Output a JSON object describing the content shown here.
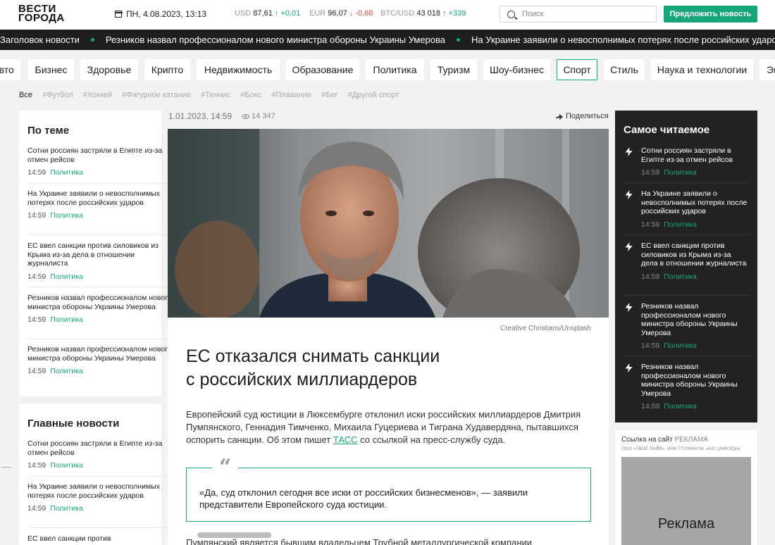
{
  "header": {
    "logo_line1": "ВЕСТИ",
    "logo_line2": "ГОРОДА",
    "date": "ПН, 4.08.2023, 13:13",
    "rates": [
      {
        "label": "USD",
        "value": "87,61",
        "change": "↑ +0,01",
        "dir": "up"
      },
      {
        "label": "EUR",
        "value": "96,07",
        "change": "↓ -0,68",
        "dir": "down"
      },
      {
        "label": "BTC/USD",
        "value": "43 018",
        "change": "↑ +339",
        "dir": "up"
      }
    ],
    "search_placeholder": "Поиск",
    "suggest_button": "Предложить новость"
  },
  "ticker": [
    "Заголовок новости",
    "Резников назвал профессионалом нового министра обороны Украины Умерова",
    "На Украине заявили о невосполнимых потерях после российских ударов"
  ],
  "categories": [
    "Авто",
    "Бизнес",
    "Здоровье",
    "Крипто",
    "Недвижимость",
    "Образование",
    "Политика",
    "Туризм",
    "Шоу-бизнес",
    "Спорт",
    "Стиль",
    "Наука и технологии",
    "Экономика"
  ],
  "active_category": "Спорт",
  "tags": [
    "Все",
    "#Футбол",
    "#Хоккей",
    "#Фигурное катание",
    "#Теннис",
    "#Бокс",
    "#Плавание",
    "#Бег",
    "#Другой спорт"
  ],
  "left": {
    "topic": {
      "title": "По теме",
      "items": [
        {
          "text": "Сотни россиян застряли в Египте из-за отмен рейсов",
          "time": "14:59",
          "rubric": "Политика"
        },
        {
          "text": "На Украине заявили о невосполнимых потерях после российских ударов",
          "time": "14:59",
          "rubric": "Политика"
        },
        {
          "text": "ЕС ввел санкции против силовиков из Крыма из-за дела в отношении журналиста",
          "time": "14:59",
          "rubric": "Политика"
        },
        {
          "text": "Резников назвал профессионалом нового министра обороны Украины Умерова",
          "time": "14:59",
          "rubric": "Политика"
        },
        {
          "text": "Резников назвал профессионалом нового министра обороны Украины Умерова",
          "time": "14:59",
          "rubric": "Политика"
        }
      ]
    },
    "main": {
      "title": "Главные новости",
      "items": [
        {
          "text": "Сотни россиян застряли в Египте из-за отмен рейсов",
          "time": "14:59",
          "rubric": "Политика"
        },
        {
          "text": "На Украине заявили о невосполнимых потерях после российских ударов",
          "time": "14:59",
          "rubric": "Политика"
        },
        {
          "text": "ЕС ввел санкции против",
          "time": "",
          "rubric": ""
        }
      ]
    }
  },
  "article": {
    "datetime": "1.01.2023, 14:59",
    "views": "14 347",
    "share": "Поделиться",
    "photo_credit": "Creative Christians/Unsplash",
    "headline_line1": "ЕС отказался снимать санкции",
    "headline_line2": "с российских миллиардеров",
    "lead_before": "Европейский суд юстиции в Люксембурге отклонил иски российских миллиардеров Дмитрия Пумпянского, Геннадия Тимченко, Михаила Гуцериева и Тиграна Худавердяна, пытавшихся оспорить санкции. Об этом пишет ",
    "lead_link": "ТАСС",
    "lead_after": " со ссылкой на пресс-службу суда.",
    "quote_mark": "“",
    "quote": "«Да, суд отклонил сегодня все иски от российских бизнесменов», — заявили представители Европейского суда юстиции.",
    "continuation": "Пумпянский является бывшим владельцем Трубной металлургической компании"
  },
  "most_read": {
    "title": "Самое читаемое",
    "items": [
      {
        "text": "Сотни россиян застряли в Египте из-за отмен рейсов",
        "time": "14:59",
        "rubric": "Политика"
      },
      {
        "text": "На Украине заявили о невосполнимых потерях после российских ударов",
        "time": "14:59",
        "rubric": "Политика"
      },
      {
        "text": "ЕС ввел санкции против силовиков из Крыма из-за дела в отношении журналиста",
        "time": "14:59",
        "rubric": "Политика"
      },
      {
        "text": "Резников назвал профессионалом нового министра обороны Украины Умерова",
        "time": "14:59",
        "rubric": "Политика"
      },
      {
        "text": "Резников назвал профессионалом нового министра обороны Украины Умерова",
        "time": "14:59",
        "rubric": "Политика"
      }
    ]
  },
  "ad": {
    "link_text": "Ссылка на сайт",
    "label": "РЕКЛАМА",
    "legal": "ООО «ТВОЁ ЛАЙВ», ИНН 7720904034, erid: LjN8K3Qpq",
    "placeholder": "Реклама"
  },
  "colors": {
    "accent": "#17a579",
    "down": "#e0463a",
    "dark": "#222222"
  }
}
